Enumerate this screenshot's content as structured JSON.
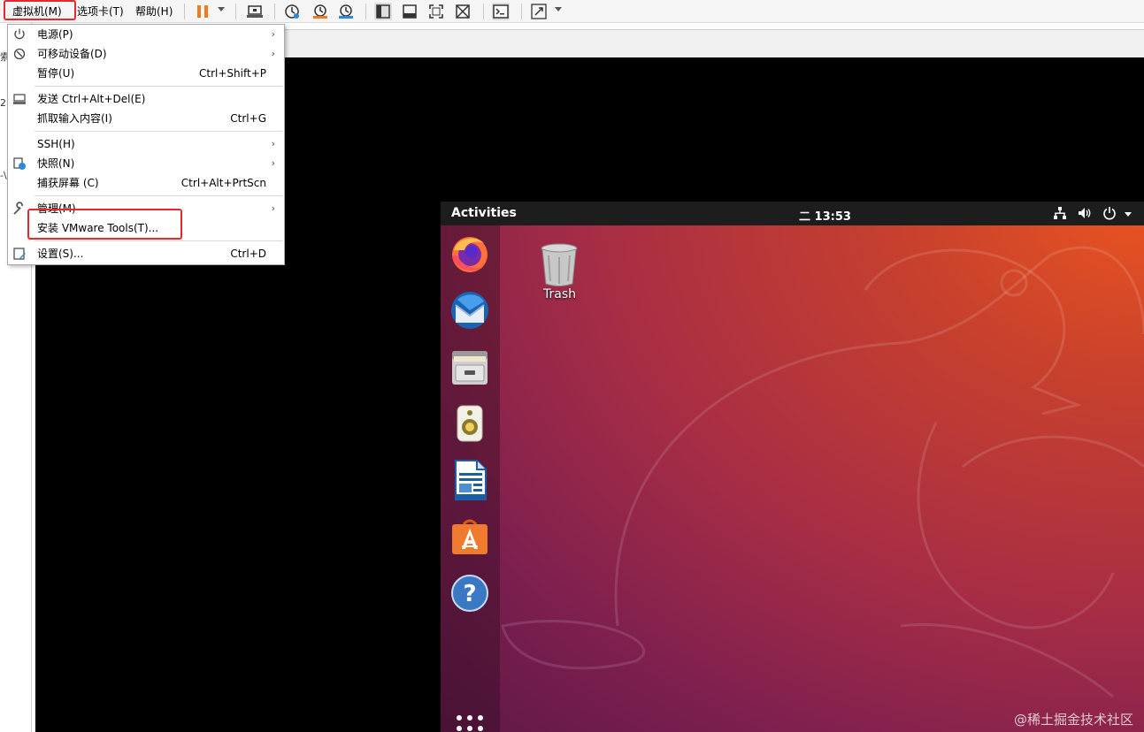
{
  "menubar": {
    "vm_label": "虚拟机(M)",
    "tabs_label": "选项卡(T)",
    "help_label": "帮助(H)",
    "toolbar_icons": [
      "pause-icon",
      "send-ctrl-alt-del-icon",
      "snapshot-icon",
      "revert-snapshot-icon",
      "snapshot-manager-icon",
      "show-library-icon",
      "thumbnail-bar-icon",
      "full-screen-icon",
      "unity-icon",
      "console-view-icon",
      "stretch-guest-icon"
    ]
  },
  "vm_menu": {
    "items": [
      {
        "label": "电源(P)",
        "shortcut": "",
        "submenu": true,
        "icon": "power-icon"
      },
      {
        "label": "可移动设备(D)",
        "shortcut": "",
        "submenu": true,
        "icon": "removable-devices-icon"
      },
      {
        "label": "暂停(U)",
        "shortcut": "Ctrl+Shift+P",
        "submenu": false,
        "icon": ""
      },
      {
        "label": "发送 Ctrl+Alt+Del(E)",
        "shortcut": "",
        "submenu": false,
        "icon": "send-keys-icon"
      },
      {
        "label": "抓取输入内容(I)",
        "shortcut": "Ctrl+G",
        "submenu": false,
        "icon": ""
      },
      {
        "label": "SSH(H)",
        "shortcut": "",
        "submenu": true,
        "icon": ""
      },
      {
        "label": "快照(N)",
        "shortcut": "",
        "submenu": true,
        "icon": "snapshot-icon"
      },
      {
        "label": "捕获屏幕 (C)",
        "shortcut": "Ctrl+Alt+PrtScn",
        "submenu": false,
        "icon": ""
      },
      {
        "label": "管理(M)",
        "shortcut": "",
        "submenu": true,
        "icon": "wrench-icon"
      },
      {
        "label": "安装 VMware Tools(T)...",
        "shortcut": "",
        "submenu": false,
        "icon": ""
      },
      {
        "label": "设置(S)...",
        "shortcut": "Ctrl+D",
        "submenu": false,
        "icon": "settings-icon"
      }
    ]
  },
  "ubuntu": {
    "activities": "Activities",
    "clock": "二 13:53",
    "trash_label": "Trash",
    "dock_apps": [
      "firefox-icon",
      "thunderbird-icon",
      "files-icon",
      "rhythmbox-icon",
      "libreoffice-writer-icon",
      "ubuntu-software-icon",
      "help-icon"
    ]
  },
  "watermark": "@稀土掘金技术社区",
  "colors": {
    "highlight_red": "#e8282a",
    "ubuntu_orange": "#e95420",
    "ubuntu_aubergine": "#5e1845",
    "pause_orange": "#f07a1e"
  }
}
